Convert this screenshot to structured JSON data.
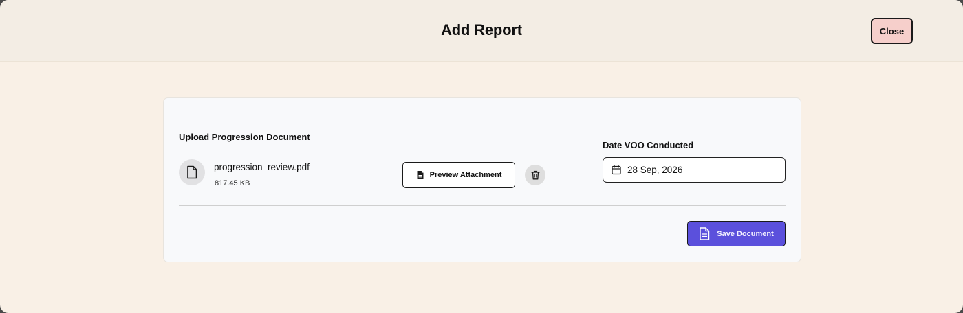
{
  "header": {
    "title": "Add Report",
    "close_label": "Close"
  },
  "upload": {
    "label": "Upload Progression Document",
    "file_icon": "file-icon",
    "file_name": "progression_review.pdf",
    "file_size": "817.45 KB",
    "preview_label": "Preview Attachment",
    "preview_icon": "document-icon",
    "delete_icon": "trash-icon"
  },
  "date": {
    "label": "Date VOO Conducted",
    "value": "28 Sep, 2026",
    "icon": "calendar-icon"
  },
  "footer": {
    "save_label": "Save Document",
    "save_icon": "document-lines-icon"
  },
  "colors": {
    "page_bg": "#f9f0e6",
    "header_bg": "#f3ede4",
    "close_bg": "#f6cfcb",
    "primary": "#5b50dc",
    "card_bg": "#f8f9fb"
  }
}
